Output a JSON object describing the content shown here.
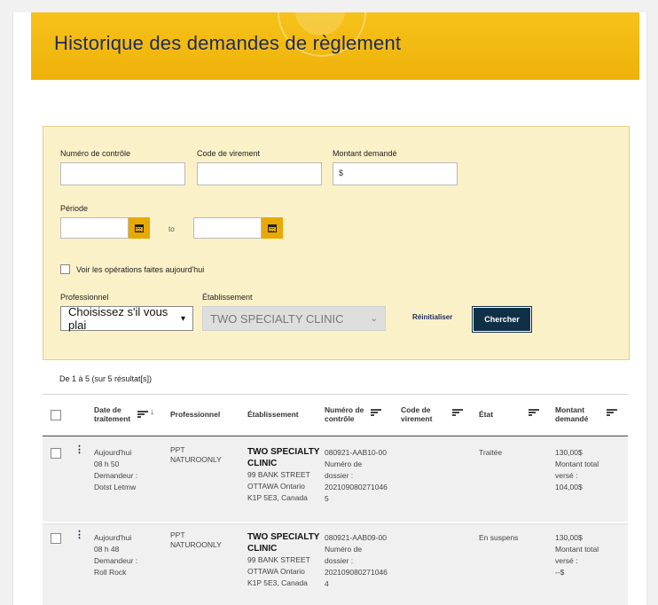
{
  "header": {
    "title": "Historique des demandes de règlement"
  },
  "filters": {
    "control_number_label": "Numéro de contrôle",
    "transfer_code_label": "Code de virement",
    "amount_label": "Montant demandé",
    "amount_value": "$",
    "period_label": "Période",
    "to_label": "to",
    "today_checkbox_label": "Voir les opérations faites aujourd'hui",
    "professional_label": "Professionnel",
    "professional_value": "Choisissez s'il vous plai",
    "establishment_label": "Établissement",
    "establishment_value": "TWO SPECIALTY CLINIC",
    "reset_label": "Réinitialiser",
    "search_label": "Chercher"
  },
  "results_summary": "De 1 à 5 (sur 5 résultat[s])",
  "table": {
    "headers": {
      "date": "Date de traitement",
      "professional": "Professionnel",
      "establishment": "Établissement",
      "control": "Numéro de contrôle",
      "transfer": "Code de virement",
      "state": "État",
      "amount": "Montant demandé"
    },
    "rows": [
      {
        "date": [
          "Aujourd'hui",
          "08 h 50",
          "Demandeur :",
          "Dotst Letmw"
        ],
        "professional": [
          "PPT",
          "NATUROONLY"
        ],
        "establishment_name": [
          "TWO SPECIALTY",
          "CLINIC"
        ],
        "establishment_address": [
          "99 BANK STREET",
          "OTTAWA Ontario",
          "K1P 5E3, Canada"
        ],
        "control": [
          "080921-AAB10-00",
          "Numéro de",
          "dossier :",
          "202109080271046",
          "5"
        ],
        "state": "Traitée",
        "amount": [
          "130,00$",
          "Montant total",
          "versé :",
          "104,00$"
        ]
      },
      {
        "date": [
          "Aujourd'hui",
          "08 h 48",
          "Demandeur :",
          "Roll Rock"
        ],
        "professional": [
          "PPT",
          "NATUROONLY"
        ],
        "establishment_name": [
          "TWO SPECIALTY",
          "CLINIC"
        ],
        "establishment_address": [
          "99 BANK STREET",
          "OTTAWA Ontario",
          "K1P 5E3, Canada"
        ],
        "control": [
          "080921-AAB09-00",
          "Numéro de",
          "dossier :",
          "202109080271046",
          "4"
        ],
        "state": "En suspens",
        "amount": [
          "130,00$",
          "Montant total",
          "versé :",
          "--$"
        ]
      }
    ]
  },
  "icons": [
    "calendar-icon",
    "sort-icon",
    "more-vertical-icon",
    "chevron-down-icon"
  ],
  "colors": {
    "banner": "#f2b90f",
    "filter_bg": "#fbf1c9",
    "search_button": "#0f3047",
    "calendar_button": "#e8a900"
  }
}
